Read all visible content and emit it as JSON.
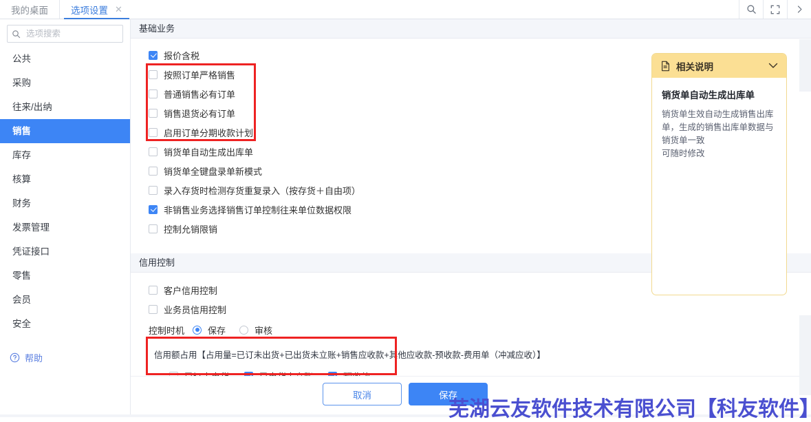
{
  "window": {
    "tabs": [
      {
        "label": "我的桌面",
        "active": false,
        "closable": false
      },
      {
        "label": "选项设置",
        "active": true,
        "closable": true,
        "close_glyph": "✕"
      }
    ],
    "tools": [
      {
        "name": "search-icon",
        "glyph": "search"
      },
      {
        "name": "fullscreen-icon",
        "glyph": "fullscreen"
      },
      {
        "name": "chevron-right-icon",
        "glyph": "chevron-right"
      }
    ]
  },
  "sidebar": {
    "search": {
      "placeholder": "选项搜索",
      "value": ""
    },
    "items": [
      {
        "label": "公共",
        "active": false
      },
      {
        "label": "采购",
        "active": false
      },
      {
        "label": "往来/出纳",
        "active": false
      },
      {
        "label": "销售",
        "active": true
      },
      {
        "label": "库存",
        "active": false
      },
      {
        "label": "核算",
        "active": false
      },
      {
        "label": "财务",
        "active": false
      },
      {
        "label": "发票管理",
        "active": false
      },
      {
        "label": "凭证接口",
        "active": false
      },
      {
        "label": "零售",
        "active": false
      },
      {
        "label": "会员",
        "active": false
      },
      {
        "label": "安全",
        "active": false
      }
    ],
    "help": {
      "label": "帮助"
    }
  },
  "main": {
    "section_basic": {
      "title": "基础业务",
      "options": [
        {
          "label": "报价含税",
          "checked": true
        },
        {
          "label": "按照订单严格销售",
          "checked": false
        },
        {
          "label": "普通销售必有订单",
          "checked": false
        },
        {
          "label": "销售退货必有订单",
          "checked": false
        },
        {
          "label": "启用订单分期收款计划",
          "checked": false
        },
        {
          "label": "销货单自动生成出库单",
          "checked": false
        },
        {
          "label": "销货单全键盘录单新模式",
          "checked": false
        },
        {
          "label": "录入存货时检测存货重复录入（按存货＋自由项）",
          "checked": false
        },
        {
          "label": "非销售业务选择销售订单控制往来单位数据权限",
          "checked": true
        },
        {
          "label": "控制允销限销",
          "checked": false
        }
      ]
    },
    "section_credit": {
      "title": "信用控制",
      "options": [
        {
          "label": "客户信用控制",
          "checked": false
        },
        {
          "label": "业务员信用控制",
          "checked": false
        }
      ],
      "timing": {
        "label": "控制时机",
        "options": [
          {
            "label": "保存",
            "selected": true
          },
          {
            "label": "审核",
            "selected": false
          }
        ]
      },
      "quota_note": "信用额占用【占用量=已订未出货+已出货未立账+销售应收款+其他应收款-预收款-费用单（冲减应收）】",
      "quota_options": [
        {
          "label": "已订未出货",
          "checked": false
        },
        {
          "label": "已出货未立账",
          "checked": true
        },
        {
          "label": "预收款",
          "checked": true
        }
      ]
    }
  },
  "info_panel": {
    "title": "相关说明",
    "heading": "销货单自动生成出库单",
    "body": "销货单生效自动生成销售出库单，生成的销售出库单数据与销货单一致\n可随时修改",
    "collapse_glyph": "⌄"
  },
  "footer": {
    "cancel_label": "取消",
    "save_label": "保存"
  },
  "overlay": {
    "watermark": "芜湖云友软件技术有限公司【科友软件】"
  },
  "colors": {
    "accent": "#3d85f5",
    "annotation": "#ee2222",
    "panel_header": "#fbdf94",
    "watermark": "#4a4fd0"
  }
}
